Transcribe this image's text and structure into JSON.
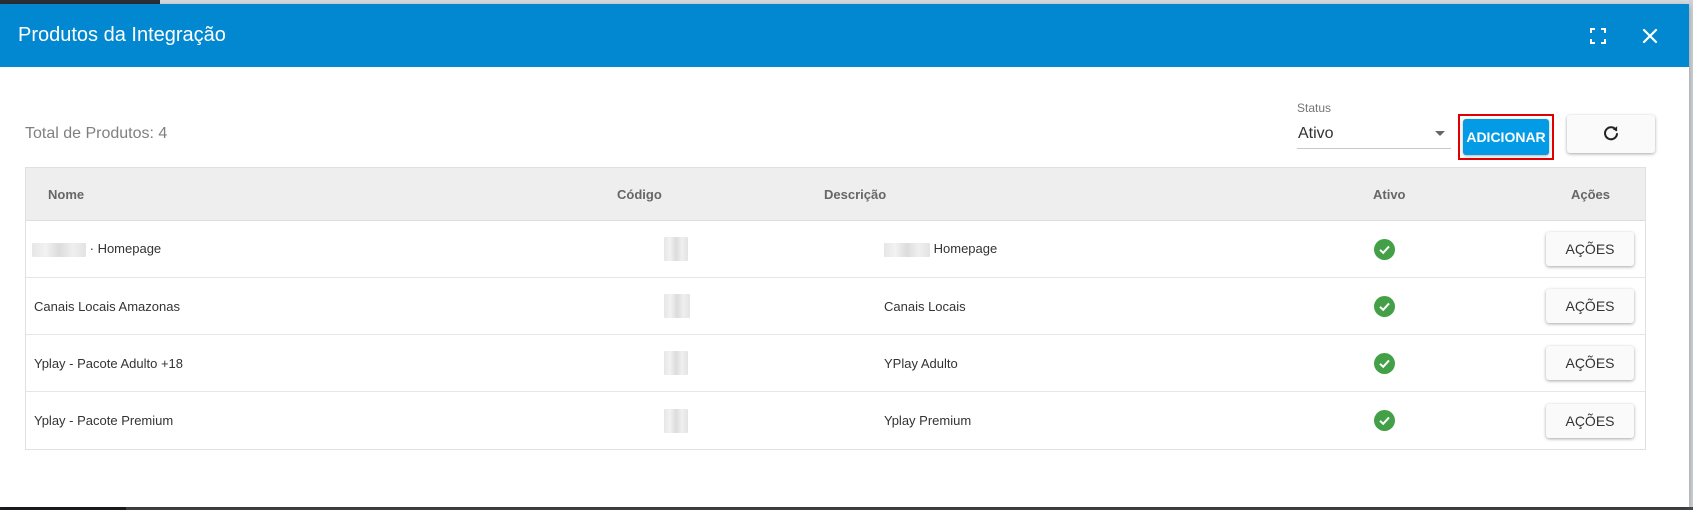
{
  "dialog": {
    "title": "Produtos da Integração",
    "maximize_icon": "fullscreen-icon",
    "close_icon": "close-icon"
  },
  "toolbar": {
    "total_label": "Total de Produtos: 4",
    "status_label": "Status",
    "status_value": "Ativo",
    "add_label": "ADICIONAR",
    "refresh_icon": "refresh-icon"
  },
  "table": {
    "headers": {
      "nome": "Nome",
      "codigo": "Código",
      "descricao": "Descrição",
      "ativo": "Ativo",
      "acoes": "Ações"
    },
    "rows": [
      {
        "nome": "· Homepage",
        "descricao": "Homepage",
        "ativo": true,
        "acoes_label": "AÇÕES"
      },
      {
        "nome": "Canais Locais Amazonas",
        "descricao": "Canais Locais",
        "ativo": true,
        "acoes_label": "AÇÕES"
      },
      {
        "nome": "Yplay - Pacote Adulto +18",
        "descricao": "YPlay Adulto",
        "ativo": true,
        "acoes_label": "AÇÕES"
      },
      {
        "nome": "Yplay - Pacote Premium",
        "descricao": "Yplay Premium",
        "ativo": true,
        "acoes_label": "AÇÕES"
      }
    ]
  },
  "colors": {
    "header_bg": "#0288d1",
    "add_button_bg": "#039be5",
    "highlight_border": "#e00000",
    "active_check": "#43a047"
  }
}
